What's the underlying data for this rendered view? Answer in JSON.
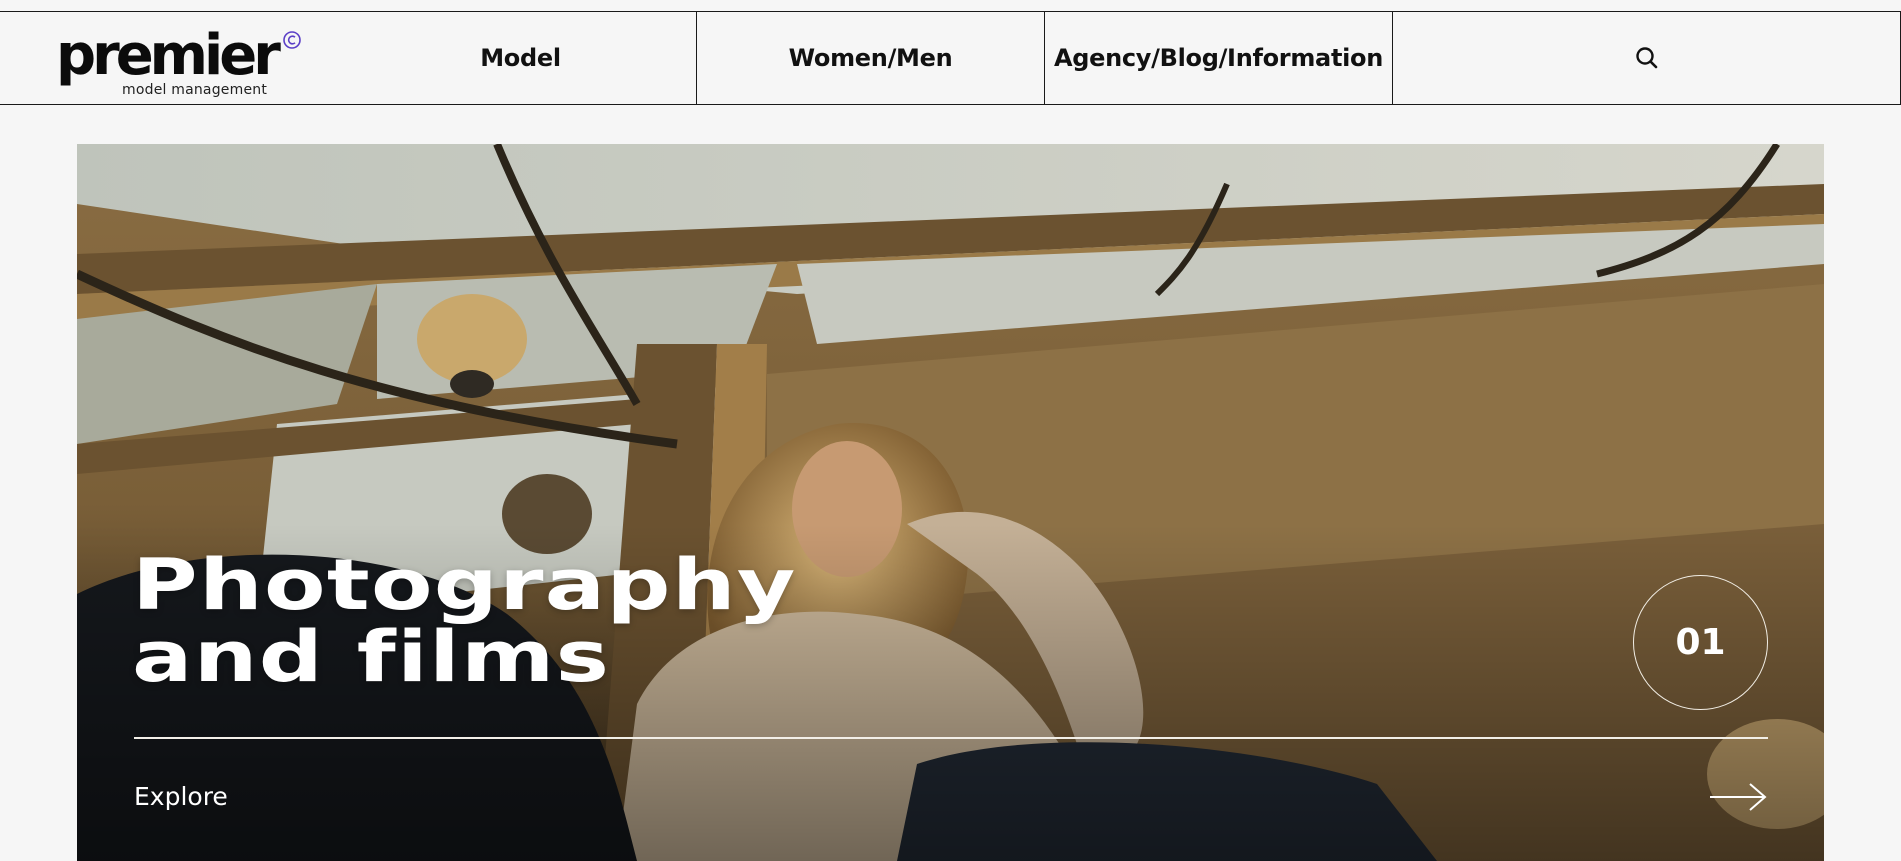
{
  "brand": {
    "name": "premier",
    "tagline": "model management"
  },
  "nav": {
    "items": [
      {
        "label": "Model"
      },
      {
        "label": "Women/Men"
      },
      {
        "label": "Agency/Blog/Information"
      }
    ],
    "search_icon": "search-icon"
  },
  "hero": {
    "title_line1": "Photography",
    "title_line2": "and films",
    "counter": "01",
    "cta_label": "Explore",
    "cta_icon": "arrow-right-icon"
  },
  "colors": {
    "background": "#f6f6f6",
    "text": "#111111",
    "logo_accent": "#5b3fc7",
    "hero_text": "#ffffff"
  }
}
